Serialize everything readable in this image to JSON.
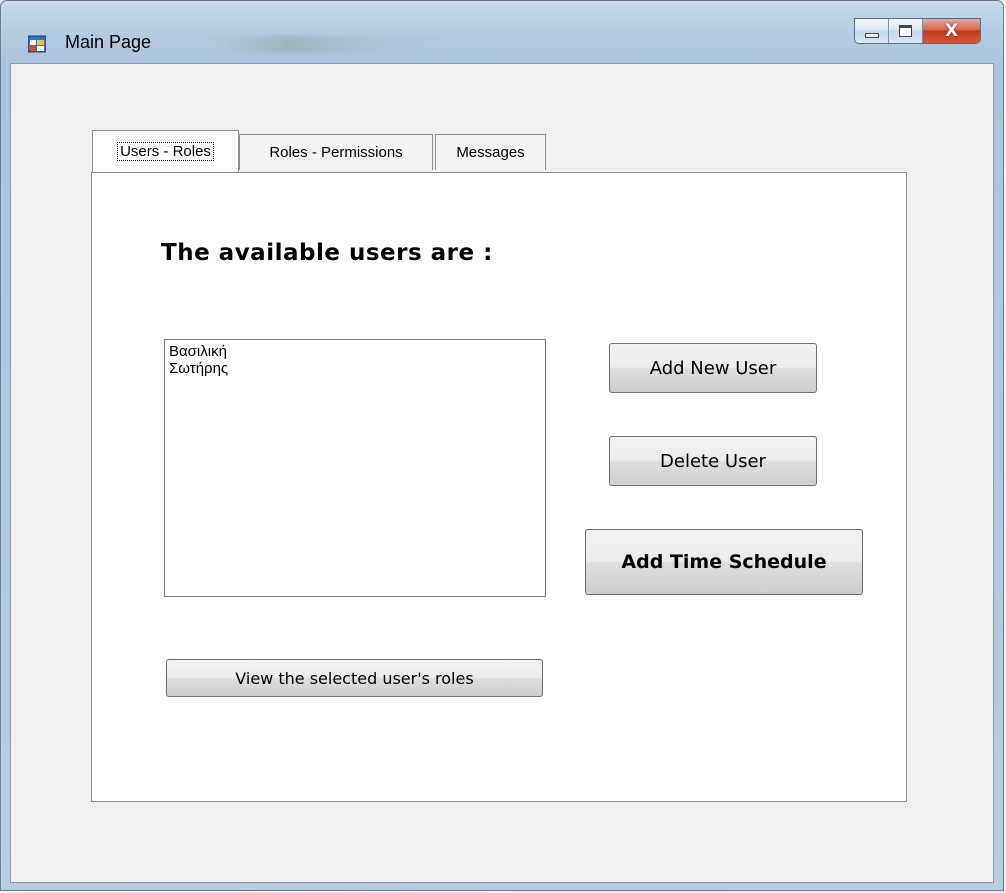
{
  "window": {
    "title": "Main Page",
    "close_glyph": "X"
  },
  "tabs": [
    {
      "label": "Users - Roles",
      "active": true
    },
    {
      "label": "Roles - Permissions",
      "active": false
    },
    {
      "label": "Messages",
      "active": false
    }
  ],
  "users_tab": {
    "heading": "The available users are :",
    "users": [
      "Βασιλική",
      "Σωτήρης"
    ],
    "add_user_label": "Add New User",
    "delete_user_label": "Delete User",
    "add_schedule_label": "Add Time Schedule",
    "view_roles_label": "View the selected user's roles"
  },
  "icons": {
    "app": "app-window-icon",
    "minimize": "minimize-icon",
    "maximize": "maximize-icon",
    "close": "close-icon"
  },
  "colors": {
    "close_button": "#c0381d",
    "panel_background": "#ffffff",
    "client_background": "#f0f0f0"
  }
}
